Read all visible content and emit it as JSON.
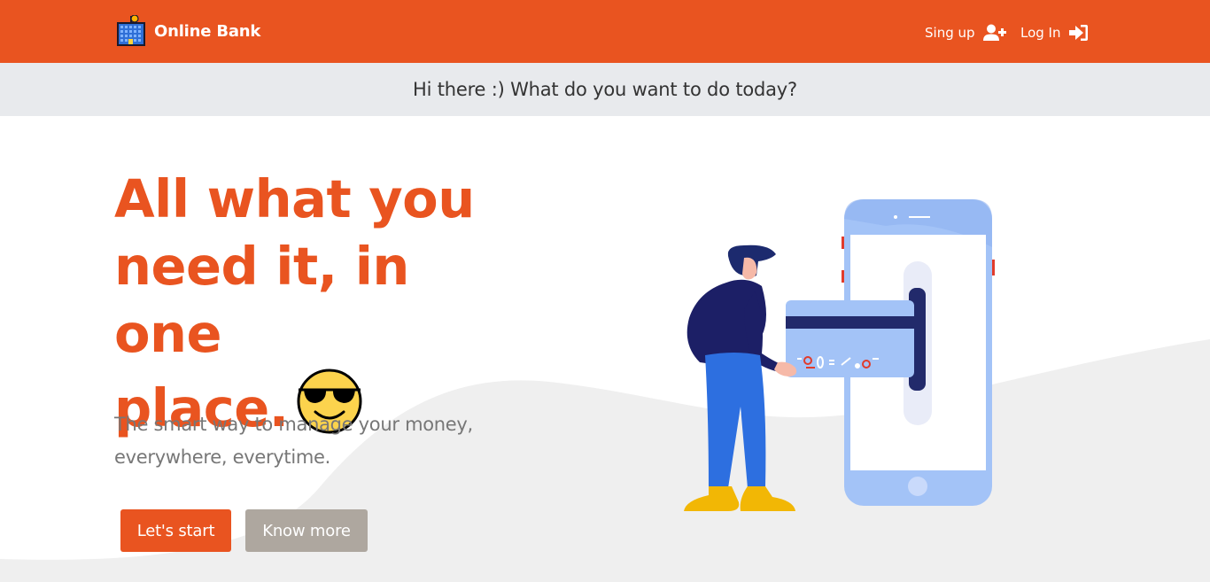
{
  "navbar": {
    "brand_name": "Online Bank",
    "brand_icon": "bank-building-icon",
    "signup_label": "Sing up",
    "signup_icon": "user-plus-icon",
    "login_label": "Log In",
    "login_icon": "sign-in-icon",
    "background_color": "#e95420"
  },
  "greeting": {
    "text": "Hi there :) What do you want to do today?"
  },
  "hero": {
    "headline_line1": "All what you",
    "headline_line2": "need it, in one",
    "headline_line3": "place.",
    "headline_emoji": "smiling-face-with-sunglasses-icon",
    "subtitle_line1": "The smart way to manage your money,",
    "subtitle_line2": "everywhere, everytime.",
    "primary_button": "Let's start",
    "secondary_button": "Know more",
    "illustration": "person-inserting-card-into-phone-illustration"
  },
  "colors": {
    "accent": "#e95420",
    "secondary_button": "#aea79f",
    "greeting_bar": "#e8eaed",
    "wave": "#efefef"
  }
}
